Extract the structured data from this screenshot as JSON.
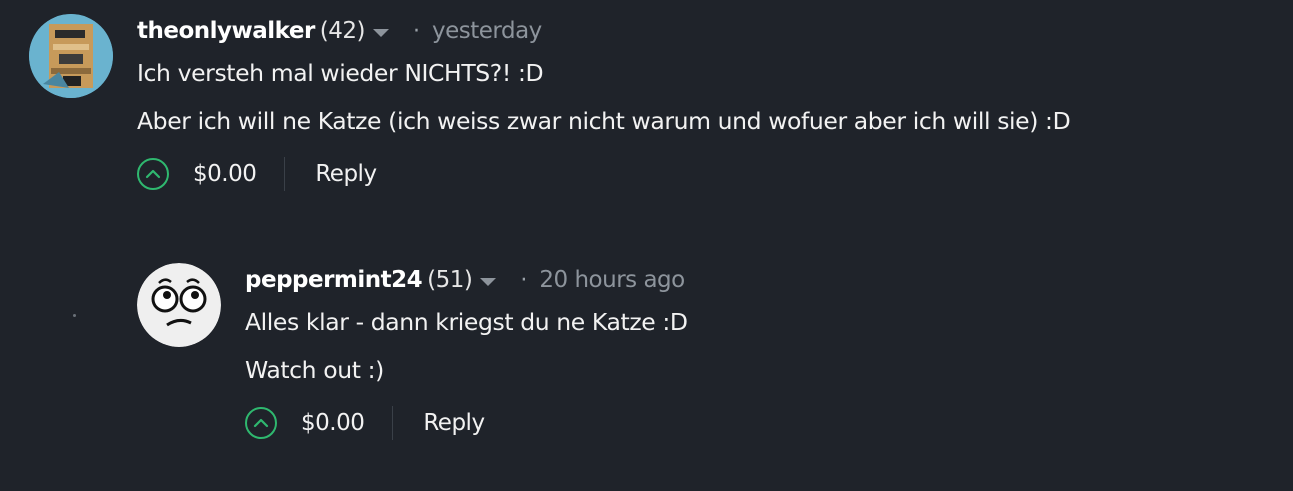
{
  "comments": [
    {
      "author": "theonlywalker",
      "reputation": "(42)",
      "separator": "·",
      "time": "yesterday",
      "lines": [
        "Ich versteh mal wieder NICHTS?! :D",
        "Aber ich will ne Katze (ich weiss zwar nicht warum und wofuer aber ich will sie) :D"
      ],
      "payout": "$0.00",
      "reply_label": "Reply"
    },
    {
      "author": "peppermint24",
      "reputation": "(51)",
      "separator": "·",
      "time": "20 hours ago",
      "lines": [
        "Alles klar - dann kriegst du ne Katze :D",
        "Watch out :)"
      ],
      "payout": "$0.00",
      "reply_label": "Reply"
    }
  ],
  "colors": {
    "background": "#1f232a",
    "upvote_accent": "#2fb86f",
    "muted_text": "#8d949c"
  },
  "icons": {
    "upvote": "chevron-up-circle-icon",
    "dropdown": "caret-down-icon"
  }
}
